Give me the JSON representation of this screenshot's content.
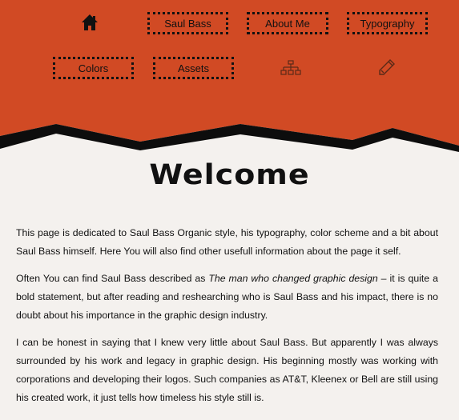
{
  "nav": {
    "home_icon": "home-icon",
    "items": [
      {
        "label": "Saul Bass"
      },
      {
        "label": "About Me"
      },
      {
        "label": "Typography"
      },
      {
        "label": "Colors"
      },
      {
        "label": "Assets"
      }
    ],
    "sitemap_icon": "sitemap-icon",
    "pencil_icon": "pencil-icon"
  },
  "colors": {
    "header": "#d14a24",
    "background": "#f4f1ee",
    "ink": "#111111"
  },
  "main": {
    "title": "Welcome",
    "p1": "This page is dedicated to Saul Bass Organic style, his typography, color scheme and a bit about Saul Bass himself. Here You will also find other usefull information about the page it self.",
    "p2_before": "Often You can find Saul Bass described as ",
    "p2_quote": "The man who changed graphic design",
    "p2_after": " – it is quite a bold statement, but after reading and reshearching who is Saul Bass and his impact, there is no doubt about his importance in the graphic design industry.",
    "p3": "I can be honest in saying that I knew very little about Saul Bass. But apparently I was always surrounded by his work and legacy in graphic design. His beginning mostly was working with corporations and developing their logos. Such companies as AT&T, Kleenex or Bell are still using his created work, it just tells how timeless his style still is."
  }
}
